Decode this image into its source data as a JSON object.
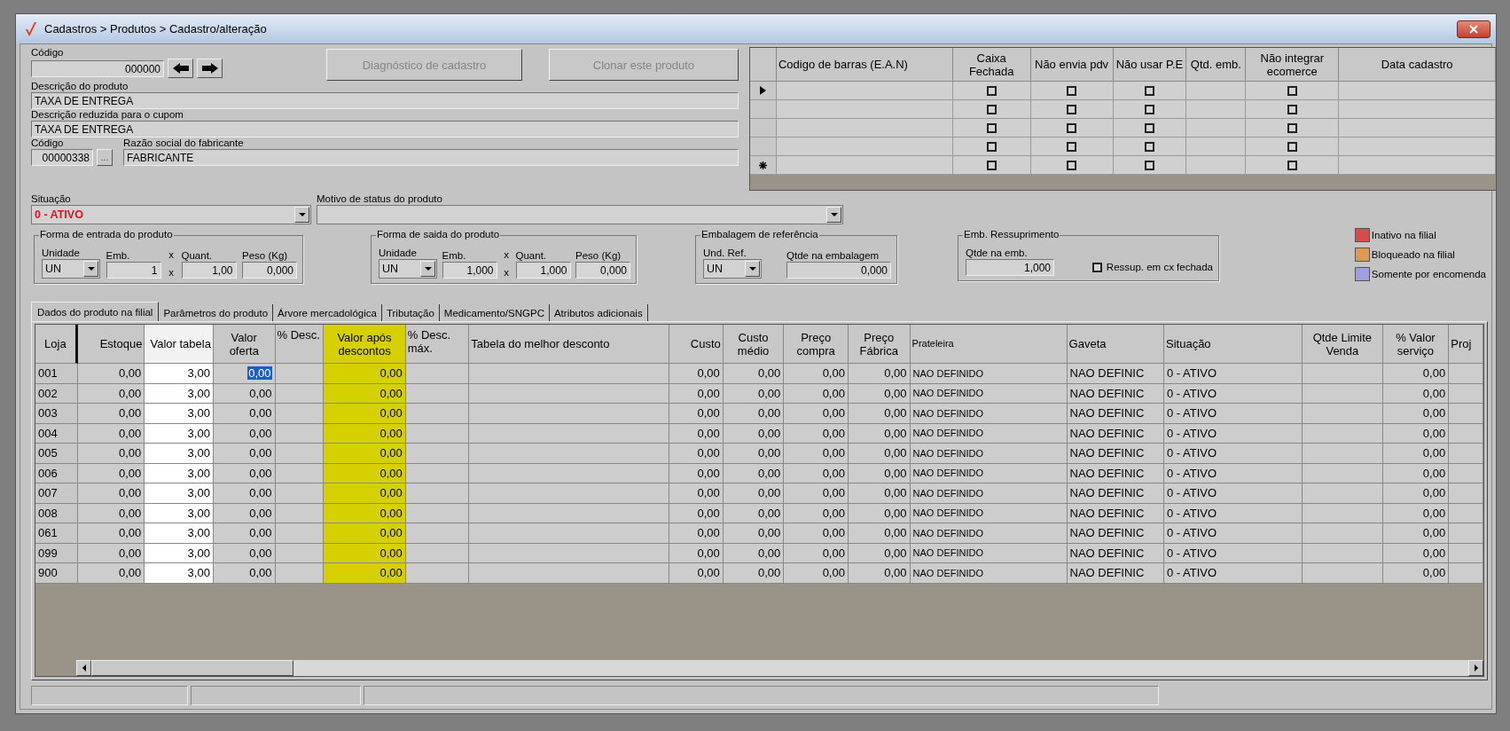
{
  "window": {
    "title": "Cadastros > Produtos > Cadastro/alteração"
  },
  "header": {
    "code_label": "Código",
    "code": "000000",
    "description_label": "Descrição  do produto",
    "description": "TAXA DE ENTREGA",
    "short_description_label": "Descrição reduzida para o cupom",
    "short_description": "TAXA DE ENTREGA",
    "maker_code_label": "Código",
    "maker_code": "00000338",
    "lookup_button": "...",
    "maker_label": "Razão social do fabricante",
    "maker": "FABRICANTE",
    "status_label": "Situação",
    "status": "0 - ATIVO",
    "reason_label": "Motivo de status do produto"
  },
  "buttons": [
    {
      "label": "Diagnóstico de cadastro",
      "disabled": true
    },
    {
      "label": "Clonar este produto",
      "disabled": true
    }
  ],
  "barcode_grid": {
    "columns": [
      {
        "label": "Codigo de barras (E.A.N)",
        "kind": "text"
      },
      {
        "label": "Caixa Fechada",
        "kind": "checkbox"
      },
      {
        "label": "Não envia pdv",
        "kind": "checkbox"
      },
      {
        "label": "Não usar P.E",
        "kind": "checkbox"
      },
      {
        "label": "Qtd. emb.",
        "kind": "text"
      },
      {
        "label": "Não integrar ecomerce",
        "kind": "checkbox"
      },
      {
        "label": "Data cadastro",
        "kind": "text"
      }
    ],
    "rows": [
      {
        "kind": "current",
        "checks": [
          false,
          false,
          false,
          false
        ]
      },
      {
        "kind": "plain",
        "checks": [
          false,
          false,
          false,
          false
        ]
      },
      {
        "kind": "plain",
        "checks": [
          false,
          false,
          false,
          false
        ]
      },
      {
        "kind": "plain",
        "checks": [
          false,
          false,
          false,
          false
        ]
      },
      {
        "kind": "new",
        "checks": [
          false,
          false,
          false,
          false
        ]
      }
    ]
  },
  "groups": [
    {
      "title": "Forma de entrada do produto",
      "fields": [
        {
          "kind": "select",
          "label": "Unidade",
          "value": "UN"
        },
        {
          "kind": "number",
          "label": "Emb.",
          "value": "1"
        },
        {
          "kind": "operator",
          "label": "x",
          "value": "x"
        },
        {
          "kind": "number",
          "label": "Quant.",
          "value": "1,00"
        },
        {
          "kind": "number",
          "label": "Peso (Kg)",
          "value": "0,000"
        }
      ]
    },
    {
      "title": "Forma de saida do produto",
      "fields": [
        {
          "kind": "select",
          "label": "Unidade",
          "value": "UN"
        },
        {
          "kind": "number",
          "label": "Emb.",
          "value": "1,000"
        },
        {
          "kind": "operator",
          "label": "x",
          "value": "x"
        },
        {
          "kind": "number",
          "label": "Quant.",
          "value": "1,000"
        },
        {
          "kind": "number",
          "label": "Peso (Kg)",
          "value": "0,000"
        }
      ]
    },
    {
      "title": "Embalagem de referência",
      "fields": [
        {
          "kind": "select",
          "label": "Und. Ref.",
          "value": "UN"
        },
        {
          "kind": "wide",
          "label": "Qtde na embalagem",
          "value": "0,000"
        }
      ]
    },
    {
      "title": "Emb. Ressuprimento",
      "fields": [
        {
          "kind": "wide",
          "label": "Qtde na emb.",
          "value": "1,000"
        },
        {
          "kind": "checkbox",
          "label": "Ressup. em cx fechada",
          "checked": false
        }
      ]
    }
  ],
  "legend": [
    {
      "label": "Inativo na filial",
      "color": "#d94a4a"
    },
    {
      "label": "Bloqueado na filial",
      "color": "#e09a50"
    },
    {
      "label": "Somente por encomenda",
      "color": "#9e9ee0"
    }
  ],
  "tabs": [
    {
      "label": "Dados do produto na filial",
      "selected": true
    },
    {
      "label": "Parâmetros do produto",
      "selected": false
    },
    {
      "label": "Árvore mercadológica",
      "selected": false
    },
    {
      "label": "Tributação",
      "selected": false
    },
    {
      "label": "Medicamento/SNGPC",
      "selected": false
    },
    {
      "label": "Atributos adicionais",
      "selected": false
    }
  ],
  "table": {
    "columns": [
      {
        "label": "Loja",
        "kind": "code"
      },
      {
        "label": "Estoque",
        "kind": "number"
      },
      {
        "label": "Valor tabela",
        "kind": "input"
      },
      {
        "label": "Valor oferta",
        "kind": "focus"
      },
      {
        "label": "% Desc.",
        "kind": "note"
      },
      {
        "label": "Valor após descontos",
        "kind": "total"
      },
      {
        "label": "% Desc. máx.",
        "kind": "note"
      },
      {
        "label": "Tabela do melhor desconto",
        "kind": "text"
      },
      {
        "label": "Custo",
        "kind": "number"
      },
      {
        "label": "Custo médio",
        "kind": "number"
      },
      {
        "label": "Preço compra",
        "kind": "number"
      },
      {
        "label": "Preço Fábrica",
        "kind": "number"
      },
      {
        "label": "Prateleira",
        "kind": "small"
      },
      {
        "label": "Gaveta",
        "kind": "text"
      },
      {
        "label": "Situação",
        "kind": "text"
      },
      {
        "label": "Qtde Limite Venda",
        "kind": "number"
      },
      {
        "label": "% Valor serviço",
        "kind": "number"
      },
      {
        "label": "Proj",
        "kind": "text"
      }
    ],
    "rows": [
      {
        "selected": true,
        "cells": [
          "001",
          "0,00",
          "3,00",
          "0,00",
          "",
          "0,00",
          "",
          "",
          "0,00",
          "0,00",
          "0,00",
          "0,00",
          "NAO DEFINIDO",
          "NAO DEFINIC",
          "0 - ATIVO",
          "",
          "0,00",
          ""
        ]
      },
      {
        "selected": false,
        "cells": [
          "002",
          "0,00",
          "3,00",
          "0,00",
          "",
          "0,00",
          "",
          "",
          "0,00",
          "0,00",
          "0,00",
          "0,00",
          "NAO DEFINIDO",
          "NAO DEFINIC",
          "0 - ATIVO",
          "",
          "0,00",
          ""
        ]
      },
      {
        "selected": false,
        "cells": [
          "003",
          "0,00",
          "3,00",
          "0,00",
          "",
          "0,00",
          "",
          "",
          "0,00",
          "0,00",
          "0,00",
          "0,00",
          "NAO DEFINIDO",
          "NAO DEFINIC",
          "0 - ATIVO",
          "",
          "0,00",
          ""
        ]
      },
      {
        "selected": false,
        "cells": [
          "004",
          "0,00",
          "3,00",
          "0,00",
          "",
          "0,00",
          "",
          "",
          "0,00",
          "0,00",
          "0,00",
          "0,00",
          "NAO DEFINIDO",
          "NAO DEFINIC",
          "0 - ATIVO",
          "",
          "0,00",
          ""
        ]
      },
      {
        "selected": false,
        "cells": [
          "005",
          "0,00",
          "3,00",
          "0,00",
          "",
          "0,00",
          "",
          "",
          "0,00",
          "0,00",
          "0,00",
          "0,00",
          "NAO DEFINIDO",
          "NAO DEFINIC",
          "0 - ATIVO",
          "",
          "0,00",
          ""
        ]
      },
      {
        "selected": false,
        "cells": [
          "006",
          "0,00",
          "3,00",
          "0,00",
          "",
          "0,00",
          "",
          "",
          "0,00",
          "0,00",
          "0,00",
          "0,00",
          "NAO DEFINIDO",
          "NAO DEFINIC",
          "0 - ATIVO",
          "",
          "0,00",
          ""
        ]
      },
      {
        "selected": false,
        "cells": [
          "007",
          "0,00",
          "3,00",
          "0,00",
          "",
          "0,00",
          "",
          "",
          "0,00",
          "0,00",
          "0,00",
          "0,00",
          "NAO DEFINIDO",
          "NAO DEFINIC",
          "0 - ATIVO",
          "",
          "0,00",
          ""
        ]
      },
      {
        "selected": false,
        "cells": [
          "008",
          "0,00",
          "3,00",
          "0,00",
          "",
          "0,00",
          "",
          "",
          "0,00",
          "0,00",
          "0,00",
          "0,00",
          "NAO DEFINIDO",
          "NAO DEFINIC",
          "0 - ATIVO",
          "",
          "0,00",
          ""
        ]
      },
      {
        "selected": false,
        "cells": [
          "061",
          "0,00",
          "3,00",
          "0,00",
          "",
          "0,00",
          "",
          "",
          "0,00",
          "0,00",
          "0,00",
          "0,00",
          "NAO DEFINIDO",
          "NAO DEFINIC",
          "0 - ATIVO",
          "",
          "0,00",
          ""
        ]
      },
      {
        "selected": false,
        "cells": [
          "099",
          "0,00",
          "3,00",
          "0,00",
          "",
          "0,00",
          "",
          "",
          "0,00",
          "0,00",
          "0,00",
          "0,00",
          "NAO DEFINIDO",
          "NAO DEFINIC",
          "0 - ATIVO",
          "",
          "0,00",
          ""
        ]
      },
      {
        "selected": false,
        "cells": [
          "900",
          "0,00",
          "3,00",
          "0,00",
          "",
          "0,00",
          "",
          "",
          "0,00",
          "0,00",
          "0,00",
          "0,00",
          "NAO DEFINIDO",
          "NAO DEFINIC",
          "0 - ATIVO",
          "",
          "0,00",
          ""
        ]
      }
    ]
  }
}
